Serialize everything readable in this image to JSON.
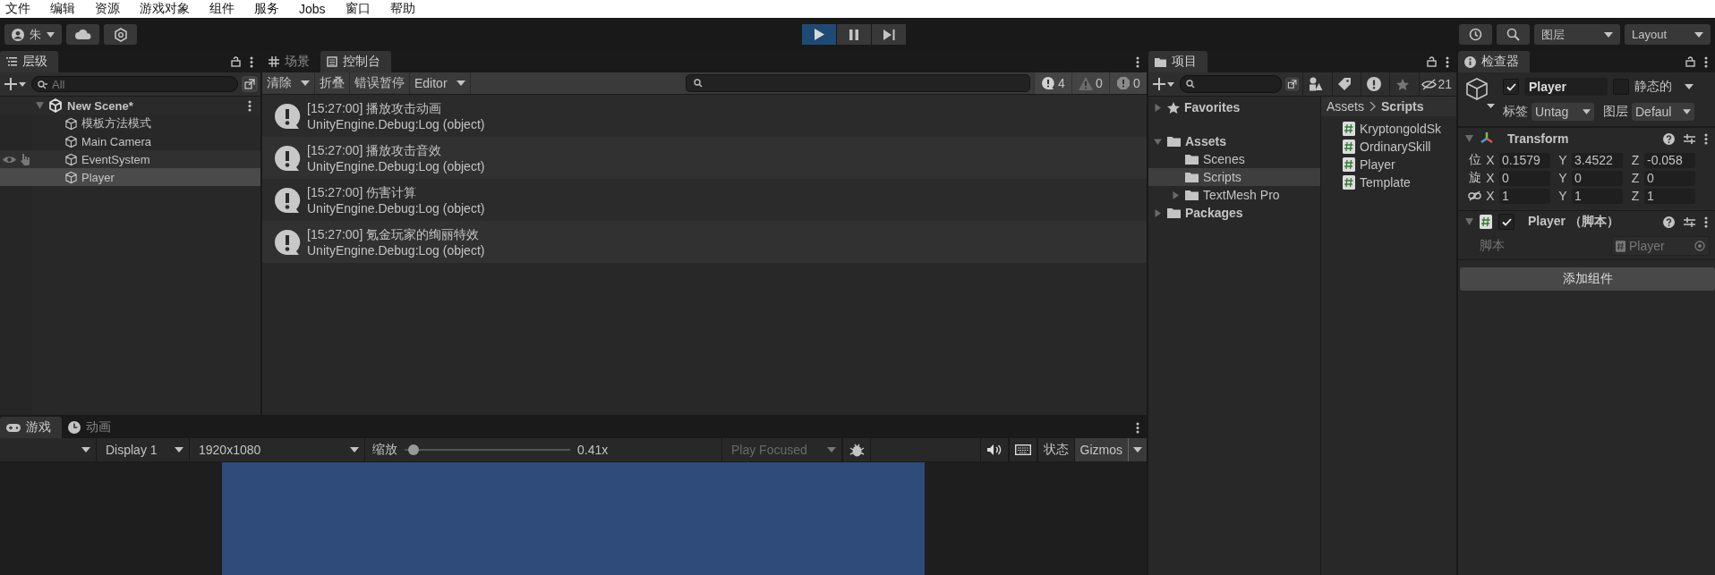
{
  "menu": [
    "文件",
    "编辑",
    "资源",
    "游戏对象",
    "组件",
    "服务",
    "Jobs",
    "窗口",
    "帮助"
  ],
  "toolbar": {
    "account": "朱",
    "playing": true,
    "layers": "图层",
    "layout": "Layout"
  },
  "hierarchy": {
    "tab": "层级",
    "search_placeholder": "All",
    "scene": "New Scene*",
    "objects": [
      {
        "name": "模板方法模式",
        "selected": false,
        "hovered": false
      },
      {
        "name": "Main Camera",
        "selected": false,
        "hovered": false
      },
      {
        "name": "EventSystem",
        "selected": false,
        "hovered": true
      },
      {
        "name": "Player",
        "selected": true,
        "hovered": false
      }
    ]
  },
  "console": {
    "tabs": [
      {
        "label": "场景",
        "kind": "scene",
        "selected": false
      },
      {
        "label": "控制台",
        "kind": "console",
        "selected": true
      }
    ],
    "buttons": [
      "清除",
      "折叠",
      "错误暂停",
      "Editor"
    ],
    "counts": [
      {
        "kind": "log",
        "value": "4"
      },
      {
        "kind": "warning",
        "value": "0"
      },
      {
        "kind": "error",
        "value": "0"
      }
    ],
    "logs": [
      {
        "message": "[15:27:00] 播放攻击动画",
        "trace": "UnityEngine.Debug:Log (object)"
      },
      {
        "message": "[15:27:00] 播放攻击音效",
        "trace": "UnityEngine.Debug:Log (object)"
      },
      {
        "message": "[15:27:00] 伤害计算",
        "trace": "UnityEngine.Debug:Log (object)"
      },
      {
        "message": "[15:27:00] 氪金玩家的绚丽特效",
        "trace": "UnityEngine.Debug:Log (object)"
      }
    ]
  },
  "game": {
    "tabs": [
      {
        "label": "游戏",
        "kind": "game",
        "selected": true
      },
      {
        "label": "动画",
        "kind": "animation",
        "selected": false
      }
    ],
    "display": "Display 1",
    "resolution": "1920x1080",
    "scale_label": "缩放",
    "scale": {
      "level": 0.02,
      "reading": "0.41x"
    },
    "play_mode": "Play Focused",
    "stats": "状态",
    "gizmos": "Gizmos"
  },
  "project": {
    "tab": "项目",
    "hidden_count": "21",
    "tree": [
      {
        "label": "Favorites",
        "kind": "favorites",
        "expanded": false,
        "selected": false
      },
      {
        "label": "Assets",
        "kind": "folder",
        "expanded": true,
        "selected": false,
        "children": [
          {
            "label": "Scenes",
            "kind": "folder",
            "selected": false
          },
          {
            "label": "Scripts",
            "kind": "folder",
            "selected": true
          },
          {
            "label": "TextMesh Pro",
            "kind": "folder",
            "expanded": false,
            "selected": false
          }
        ]
      },
      {
        "label": "Packages",
        "kind": "folder",
        "expanded": false,
        "selected": false
      }
    ],
    "breadcrumb": [
      "Assets",
      "Scripts"
    ],
    "files": [
      "KryptongoldSk",
      "OrdinarySkill",
      "Player",
      "Template"
    ]
  },
  "inspector": {
    "tab": "检查器",
    "active": true,
    "name": "Player",
    "static": false,
    "static_label": "静态的",
    "tag_label": "标签",
    "tag": "Untag",
    "layer_label": "图层",
    "layer": "Defaul",
    "transform": {
      "title": "Transform",
      "rows": [
        {
          "kind": "label",
          "label": "位",
          "values": [
            {
              "axis": "X",
              "value": "0.1579"
            },
            {
              "axis": "Y",
              "value": "3.4522"
            },
            {
              "axis": "Z",
              "value": "-0.058"
            }
          ]
        },
        {
          "kind": "label",
          "label": "旋",
          "values": [
            {
              "axis": "X",
              "value": "0"
            },
            {
              "axis": "Y",
              "value": "0"
            },
            {
              "axis": "Z",
              "value": "0"
            }
          ]
        },
        {
          "kind": "link",
          "values": [
            {
              "axis": "X",
              "value": "1"
            },
            {
              "axis": "Y",
              "value": "1"
            },
            {
              "axis": "Z",
              "value": "1"
            }
          ]
        }
      ]
    },
    "script": {
      "title": "Player （脚本）",
      "enabled": true,
      "field_label": "脚本",
      "field_value": "Player"
    },
    "add_component": "添加组件"
  }
}
